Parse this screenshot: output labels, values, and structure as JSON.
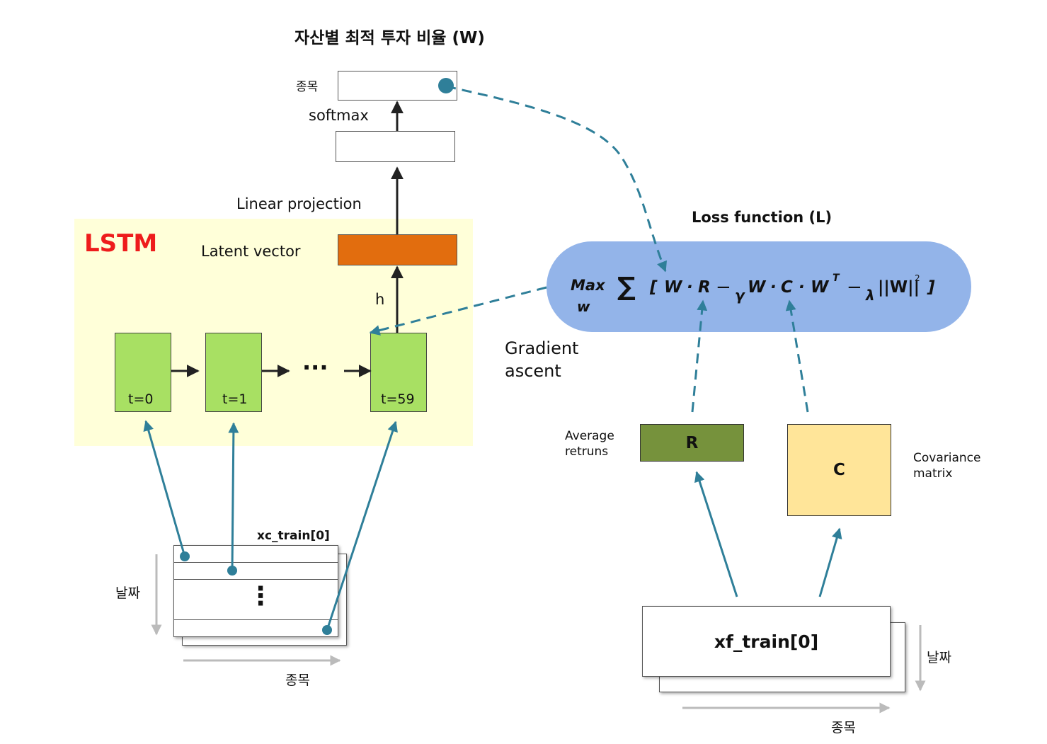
{
  "title": "자산별 최적 투자 비율 (W)",
  "output": {
    "row_label": "종목",
    "softmax_label": "softmax",
    "linear_projection_label": "Linear projection",
    "latent_vector_label": "Latent vector"
  },
  "lstm": {
    "label": "LSTM",
    "h_label": "h",
    "ellipsis": "···",
    "cells": [
      "t=0",
      "t=1",
      "t=59"
    ]
  },
  "loss": {
    "title": "Loss function (L)",
    "formula": {
      "max": "Max",
      "max_sub": "w",
      "sigma": "∑",
      "open": "[",
      "w1": "W",
      "dot1": "·",
      "r": "R",
      "minus1": "−",
      "gamma": "γ",
      "w2": "W",
      "dot2": "·",
      "c": "C",
      "dot3": "·",
      "w3": "W",
      "t": "T",
      "minus2": "−",
      "lambda": "λ",
      "norm": "||W||",
      "sq": "2",
      "close": "]"
    }
  },
  "gradient_label_line1": "Gradient",
  "gradient_label_line2": "ascent",
  "average_returns": {
    "label_line1": "Average",
    "label_line2": "retruns",
    "box": "R"
  },
  "covariance": {
    "label_line1": "Covariance",
    "label_line2": "matrix",
    "box": "C"
  },
  "xc_train": {
    "label": "xc_train[0]",
    "date_label": "날짜",
    "stock_label": "종목",
    "vdots": "⋮"
  },
  "xf_train": {
    "label": "xf_train[0]",
    "date_label": "날짜",
    "stock_label": "종목"
  },
  "colors": {
    "lstm_bg": "#FFFFD9",
    "lstm_label": "#EE1C1C",
    "cell_fill": "#A8E063",
    "latent_fill": "#E26D0E",
    "loss_fill": "#93B4E9",
    "r_fill": "#76923C",
    "c_fill": "#FFE599",
    "arrow_teal": "#2F7F99"
  }
}
